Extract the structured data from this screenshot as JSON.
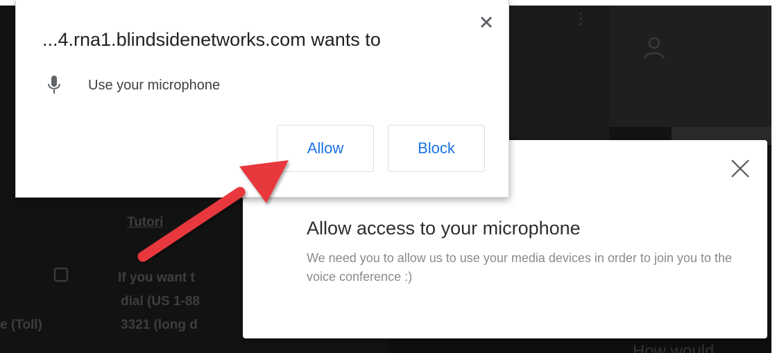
{
  "permission_prompt": {
    "title": "...4.rna1.blindsidenetworks.com wants to",
    "permission_label": "Use your microphone",
    "allow_label": "Allow",
    "block_label": "Block",
    "close_icon": "close-icon",
    "mic_icon": "microphone-icon",
    "accent_color": "#1a73e8"
  },
  "app_modal": {
    "title": "Allow access to your microphone",
    "description": "We need you to allow us to use your media devices in order to join you to the voice conference :)",
    "close_icon": "close-icon"
  },
  "annotation": {
    "arrow_color": "#e8383d"
  },
  "background_text": {
    "line1": "Tutori",
    "line2": "If you want t",
    "line3": "dial (US 1-88",
    "line4": "3321 (long d",
    "line5": "e (Toll)",
    "line6": "How would"
  }
}
